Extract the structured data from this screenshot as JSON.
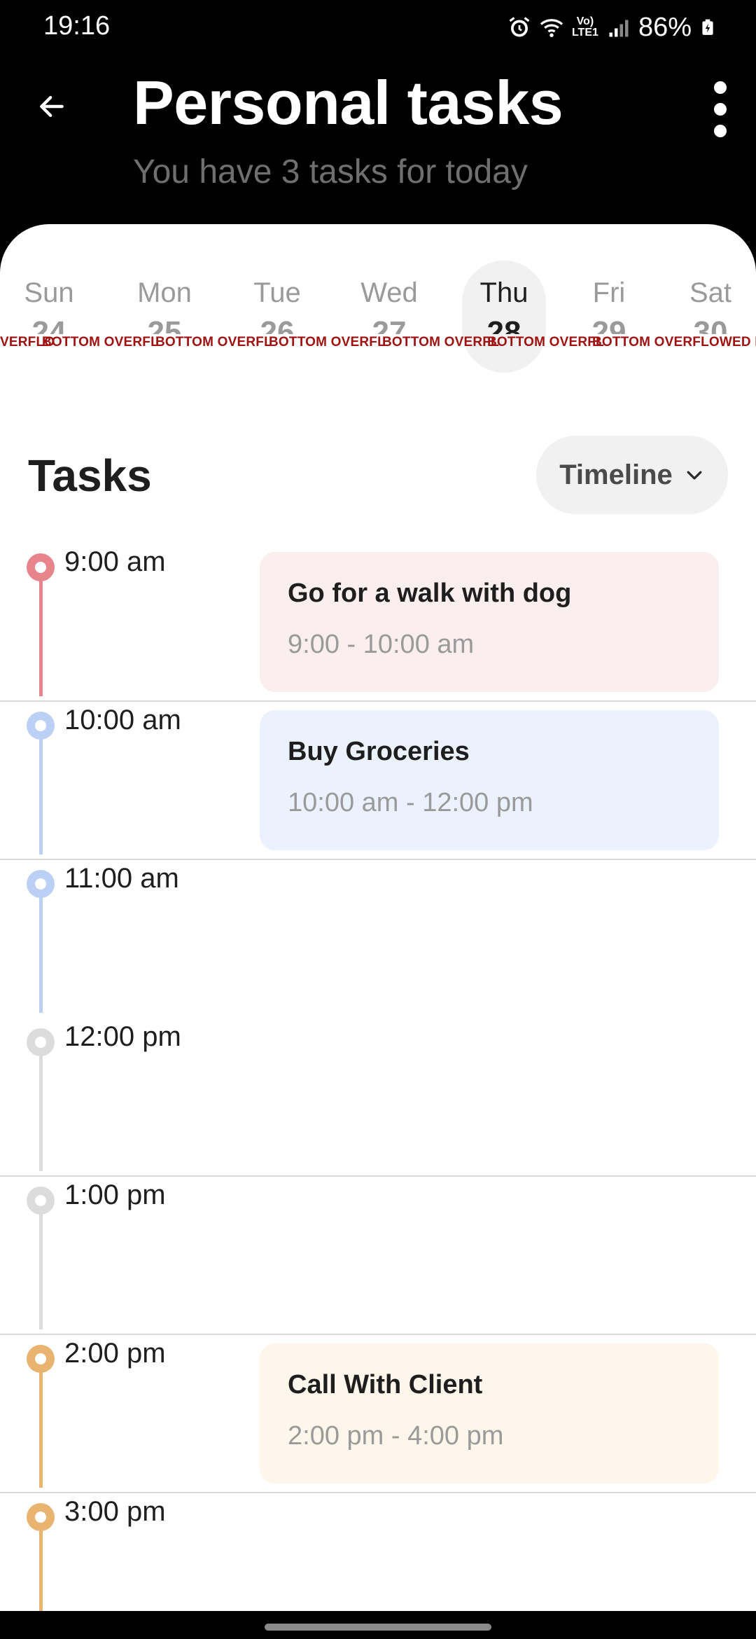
{
  "status_bar": {
    "time": "19:16",
    "battery_pct": "86%",
    "icons": [
      "alarm-icon",
      "wifi-icon",
      "volte-lte-icon",
      "signal-icon",
      "battery-icon"
    ],
    "volte_label": "Vo) LTE1"
  },
  "header": {
    "title": "Personal tasks",
    "subtitle": "You have 3 tasks for today",
    "back_icon": "arrow-left-icon",
    "menu_icon": "more-vert-icon"
  },
  "week": {
    "days": [
      {
        "name": "Sun",
        "num": "24"
      },
      {
        "name": "Mon",
        "num": "25"
      },
      {
        "name": "Tue",
        "num": "26"
      },
      {
        "name": "Wed",
        "num": "27"
      },
      {
        "name": "Thu",
        "num": "28"
      },
      {
        "name": "Fri",
        "num": "29"
      },
      {
        "name": "Sat",
        "num": "30"
      }
    ],
    "selected": "Thu",
    "overflow_segments": [
      "VERFLO",
      "BOTTOM OVERFL",
      "BOTTOM OVERFL",
      "BOTTOM OVERFL",
      "BOTTOM OVERFL",
      "BOTTOM OVERFL",
      "BOTTOM OVERFLOWED BY"
    ]
  },
  "tasks_section": {
    "title": "Tasks",
    "view_label": "Timeline",
    "view_icon": "chevron-down-icon"
  },
  "timeline": [
    {
      "time": "9:00 am",
      "color": "#e8848c"
    },
    {
      "time": "10:00 am",
      "color": "#bcd0f5"
    },
    {
      "time": "11:00 am",
      "color": "#bcd0f5"
    },
    {
      "time": "12:00 pm",
      "color": "#dcdcdc"
    },
    {
      "time": "1:00 pm",
      "color": "#dcdcdc"
    },
    {
      "time": "2:00 pm",
      "color": "#e8b470"
    },
    {
      "time": "3:00 pm",
      "color": "#e8b470"
    }
  ],
  "tasks": [
    {
      "title": "Go for a walk with dog",
      "time": "9:00 - 10:00 am",
      "bg": "#fbeeef"
    },
    {
      "title": "Buy Groceries",
      "time": "10:00 am - 12:00 pm",
      "bg": "#ebf2fd"
    },
    {
      "title": "Call With Client",
      "time": "2:00 pm - 4:00 pm",
      "bg": "#fef6ea"
    }
  ],
  "colors": {
    "background": "#000000",
    "sheet": "#ffffff",
    "chip": "#f1f1f1",
    "overflow_text": "#a01212"
  }
}
